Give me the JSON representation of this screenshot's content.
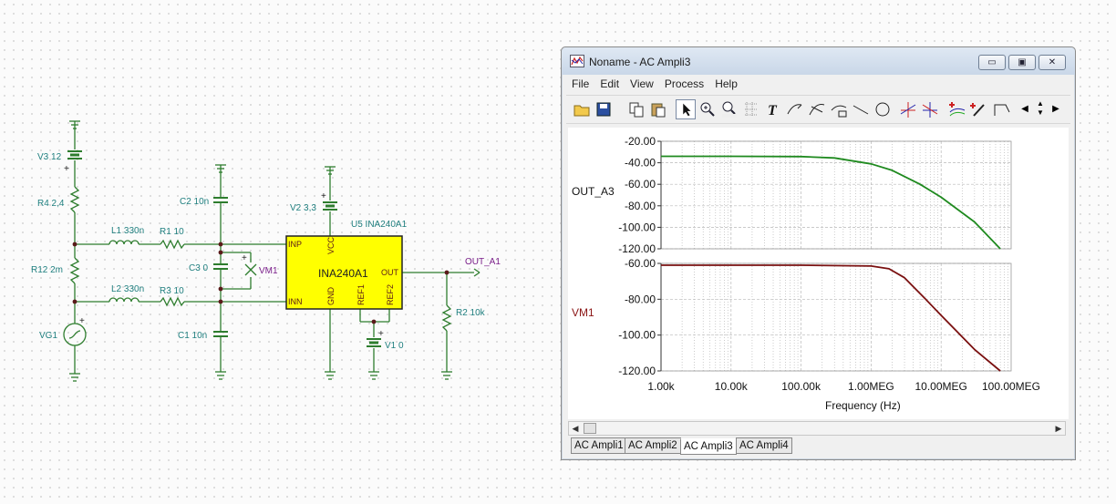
{
  "schematic": {
    "components": {
      "v3": "V3 12",
      "r4": "R4 2,4",
      "r12": "R12 2m",
      "vg1": "VG1",
      "l1": "L1 330n",
      "r1": "R1 10",
      "l2": "L2 330n",
      "r3": "R3 10",
      "c2": "C2 10n",
      "c3": "C3 0",
      "c1": "C1 10n",
      "vm1": "VM1",
      "v2": "V2 3,3",
      "u5": "U5 INA240A1",
      "chip": "INA240A1",
      "v1": "V1 0",
      "r2": "R2 10k",
      "out": "OUT_A1"
    },
    "pins": {
      "inp": "INP",
      "inn": "INN",
      "vcc": "VCC",
      "gnd": "GND",
      "ref1": "REF1",
      "ref2": "REF2",
      "out": "OUT"
    },
    "signs": {
      "plus": "+"
    }
  },
  "window": {
    "title": "Noname - AC Ampli3",
    "buttons": {
      "minimize": "▭",
      "restore": "▣",
      "close": "✕"
    },
    "menu": [
      "File",
      "Edit",
      "View",
      "Process",
      "Help"
    ],
    "tabs": [
      "AC Ampli1",
      "AC Ampli2",
      "AC Ampli3",
      "AC Ampli4"
    ],
    "active_tab": "AC Ampli3"
  },
  "chart_data": [
    {
      "type": "line",
      "ylabel": "OUT_A3",
      "ylim": [
        -120,
        -20
      ],
      "yticks": [
        "-20.00",
        "-40.00",
        "-60.00",
        "-80.00",
        "-100.00",
        "-120.00"
      ],
      "xscale": "log",
      "xlim": [
        1000,
        100000000
      ],
      "grid": true,
      "series": [
        {
          "color": "#1f8a1f",
          "x": [
            1000,
            10000,
            100000,
            300000,
            1000000,
            2000000,
            5000000,
            10000000,
            30000000,
            70000000
          ],
          "y": [
            -34,
            -34,
            -34.2,
            -35.5,
            -41,
            -47,
            -60,
            -72,
            -95,
            -120
          ]
        }
      ]
    },
    {
      "type": "line",
      "ylabel": "VM1",
      "ylim": [
        -120,
        -60
      ],
      "yticks": [
        "-60.00",
        "-80.00",
        "-100.00",
        "-120.00"
      ],
      "xscale": "log",
      "xlim": [
        1000,
        100000000
      ],
      "xticks": [
        "1.00k",
        "10.00k",
        "100.00k",
        "1.00MEG",
        "10.00MEG",
        "100.00MEG"
      ],
      "xlabel": "Frequency (Hz)",
      "grid": true,
      "series": [
        {
          "color": "#7a1010",
          "x": [
            1000,
            10000,
            100000,
            1000000,
            1800000,
            3000000,
            6000000,
            10000000,
            30000000,
            70000000
          ],
          "y": [
            -61,
            -61,
            -61,
            -61.5,
            -63,
            -68,
            -80,
            -89,
            -108,
            -120
          ]
        }
      ]
    }
  ]
}
